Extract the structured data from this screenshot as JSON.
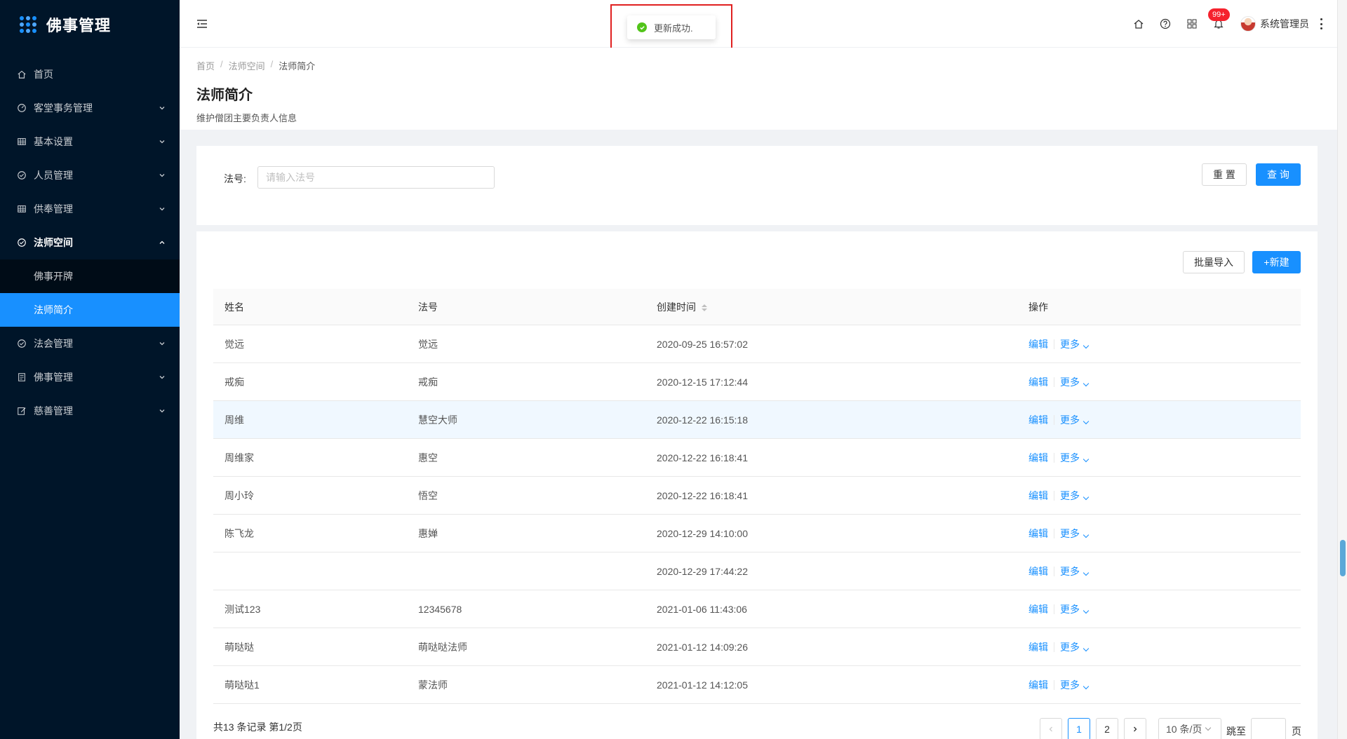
{
  "app": {
    "title": "佛事管理"
  },
  "sidebar": {
    "items": [
      {
        "label": "首页",
        "icon": "home-icon"
      },
      {
        "label": "客堂事务管理",
        "icon": "dashboard-icon"
      },
      {
        "label": "基本设置",
        "icon": "table-icon"
      },
      {
        "label": "人员管理",
        "icon": "check-circle-icon"
      },
      {
        "label": "供奉管理",
        "icon": "table-icon"
      },
      {
        "label": "法师空间",
        "icon": "check-circle-icon",
        "open": true,
        "children": [
          {
            "label": "佛事开牌"
          },
          {
            "label": "法师简介",
            "active": true
          }
        ]
      },
      {
        "label": "法会管理",
        "icon": "check-circle-icon"
      },
      {
        "label": "佛事管理",
        "icon": "form-icon"
      },
      {
        "label": "慈善管理",
        "icon": "edit-icon"
      }
    ]
  },
  "header": {
    "badge": "99+",
    "user_name": "系统管理员"
  },
  "toast": {
    "message": "更新成功."
  },
  "breadcrumb": [
    "首页",
    "法师空间",
    "法师简介"
  ],
  "page": {
    "title": "法师简介",
    "description": "维护僧团主要负责人信息"
  },
  "search": {
    "label": "法号:",
    "placeholder": "请输入法号",
    "reset_label": "重 置",
    "query_label": "查 询"
  },
  "toolbar": {
    "import_label": "批量导入",
    "new_label": "+新建"
  },
  "table": {
    "columns": [
      "姓名",
      "法号",
      "创建时间",
      "操作"
    ],
    "rows": [
      {
        "name": "觉远",
        "dharma": "觉远",
        "created": "2020-09-25 16:57:02"
      },
      {
        "name": "戒痴",
        "dharma": "戒痴",
        "created": "2020-12-15 17:12:44"
      },
      {
        "name": "周维",
        "dharma": "慧空大师",
        "created": "2020-12-22 16:15:18",
        "highlight": true
      },
      {
        "name": "周维家",
        "dharma": "惠空",
        "created": "2020-12-22 16:18:41"
      },
      {
        "name": "周小玲",
        "dharma": "悟空",
        "created": "2020-12-22 16:18:41"
      },
      {
        "name": "陈飞龙",
        "dharma": "惠婵",
        "created": "2020-12-29 14:10:00"
      },
      {
        "name": "",
        "dharma": "",
        "created": "2020-12-29 17:44:22"
      },
      {
        "name": "测试123",
        "dharma": "12345678",
        "created": "2021-01-06 11:43:06"
      },
      {
        "name": "萌哒哒",
        "dharma": "萌哒哒法师",
        "created": "2021-01-12 14:09:26"
      },
      {
        "name": "萌哒哒1",
        "dharma": "蒙法师",
        "created": "2021-01-12 14:12:05"
      }
    ],
    "edit_label": "编辑",
    "more_label": "更多"
  },
  "pagination": {
    "summary": "共13 条记录 第1/2页",
    "pages": [
      "1",
      "2"
    ],
    "current": "1",
    "page_size": "10 条/页",
    "jump_label": "跳至",
    "jump_suffix": "页"
  }
}
